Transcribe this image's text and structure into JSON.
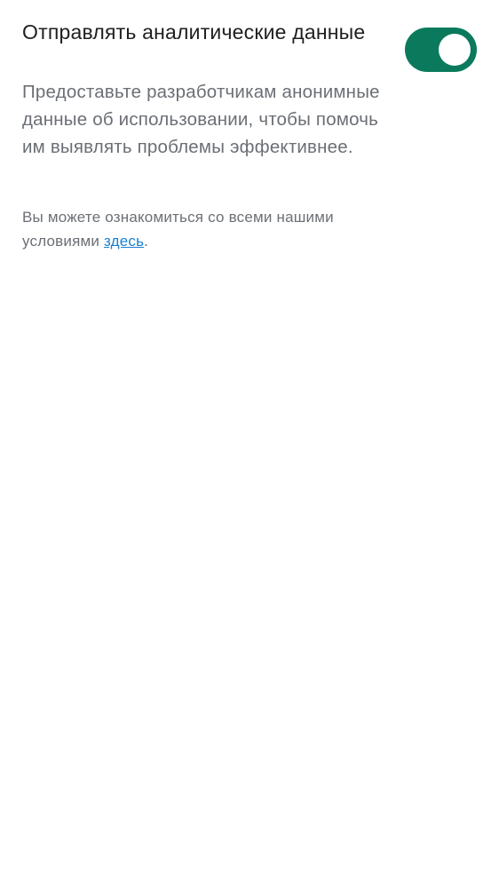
{
  "analytics_setting": {
    "title": "Отправлять аналитические данные",
    "description": "Предоставьте разработчикам анонимные данные об использовании, чтобы помочь им выявлять проблемы эффективнее.",
    "toggle_on": true,
    "toggle_color": "#0b7a5c"
  },
  "terms": {
    "prefix": "Вы можете ознакомиться со всеми нашими условиями ",
    "link_label": "здесь",
    "suffix": ".",
    "link_color": "#1a7fd0"
  }
}
